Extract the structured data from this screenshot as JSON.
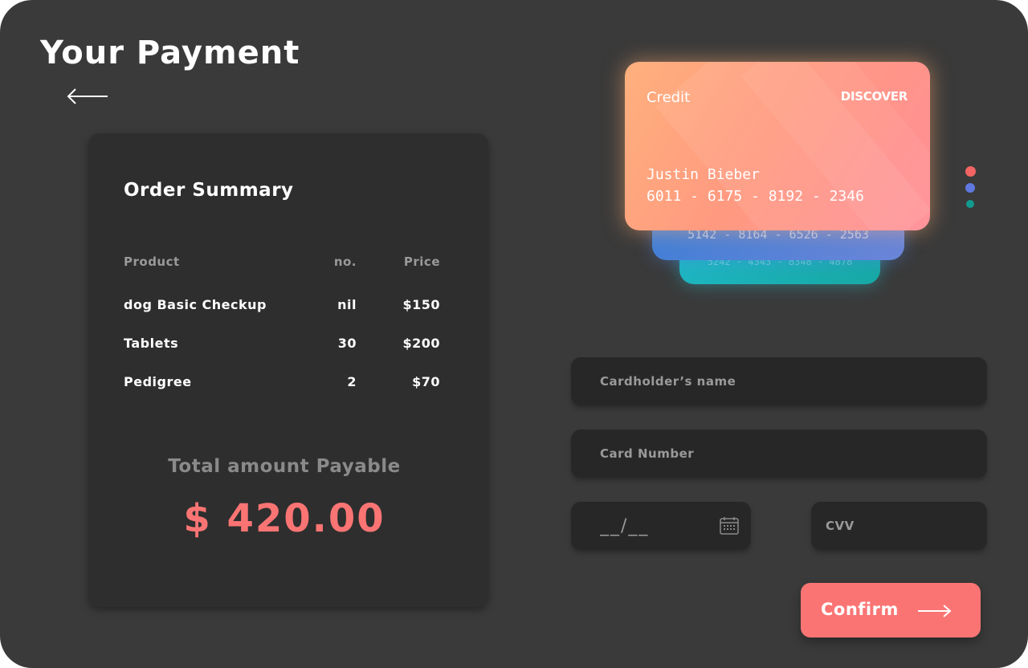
{
  "header": {
    "title": "Your Payment",
    "back_icon": "arrow-left-icon"
  },
  "order_summary": {
    "title": "Order Summary",
    "columns": [
      "Product",
      "no.",
      "Price"
    ],
    "rows": [
      {
        "product": "dog Basic Checkup",
        "qty": "nil",
        "price": "$150"
      },
      {
        "product": "Tablets",
        "qty": "30",
        "price": "$200"
      },
      {
        "product": "Pedigree",
        "qty": "2",
        "price": "$70"
      }
    ],
    "total_label": "Total amount Payable",
    "total_amount": "$ 420.00"
  },
  "cards": {
    "front": {
      "type": "Credit",
      "brand": "DISCOVER",
      "holder": "Justin Bieber",
      "number": "6011 - 6175 - 8192 - 2346"
    },
    "back_1": {
      "number": "5142 - 8164 - 6526 - 2563"
    },
    "back_2": {
      "number": "5242 - 4343 - 8348 - 4878"
    },
    "selector_colors": [
      "#f36464",
      "#5f78e0",
      "#129a8f"
    ]
  },
  "form": {
    "cardholder_placeholder": "Cardholder’s name",
    "card_number_placeholder": "Card Number",
    "expiry_placeholder": "__/__",
    "cvv_placeholder": "CVV",
    "calendar_icon": "calendar-icon"
  },
  "confirm": {
    "label": "Confirm",
    "icon": "arrow-right-icon"
  },
  "colors": {
    "background": "#3a3a3a",
    "panel": "#2e2e2e",
    "field": "#272727",
    "accent": "#fb7474"
  }
}
